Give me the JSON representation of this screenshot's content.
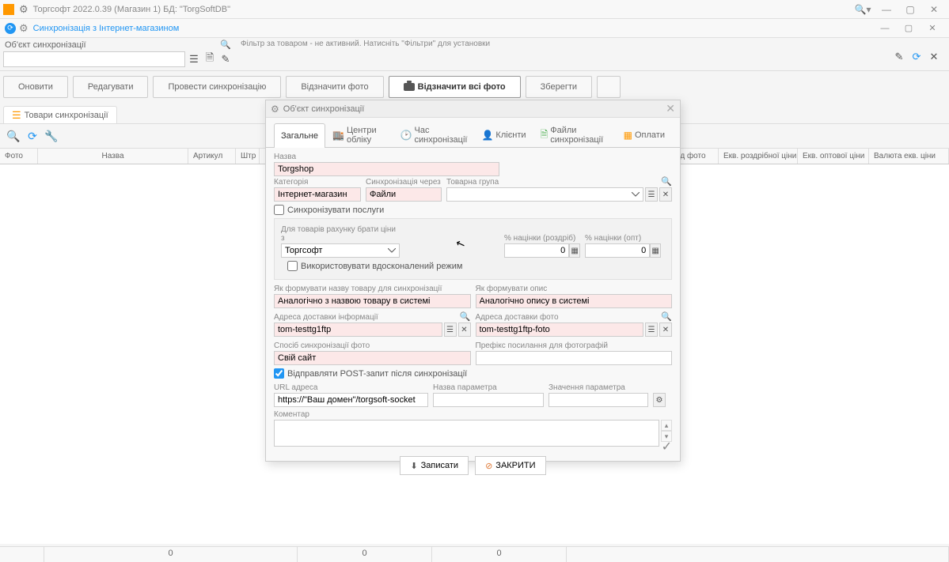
{
  "main_title": "Торгсофт 2022.0.39 (Магазин 1) БД: \"TorgSoftDB\"",
  "sub_title": "Синхронізація з Інтернет-магазином",
  "object_sync_label": "Об'єкт синхронізації",
  "filter_label": "Фільтр за товаром - не активний. Натисніть \"Фільтри\" для установки",
  "toolbar": {
    "refresh": "Оновити",
    "edit": "Редагувати",
    "sync": "Провести синхронізацію",
    "mark_photo": "Відзначити фото",
    "mark_all_photo": "Відзначити всі фото",
    "save": "Зберегти"
  },
  "app_tab": "Товари синхронізації",
  "grid_cols": {
    "photo": "Фото",
    "name": "Назва",
    "article": "Артикул",
    "barcode": "Штр",
    "under_photo": "од фото",
    "retail_eq": "Екв. роздрібної ціни",
    "wholesale_eq": "Екв. оптової ціни",
    "currency_eq": "Валюта екв. ціни"
  },
  "status": {
    "c1": "0",
    "c2": "0",
    "c3": "0"
  },
  "dialog": {
    "title": "Об'єкт синхронізації",
    "tabs": {
      "general": "Загальне",
      "centers": "Центри обліку",
      "time": "Час синхронізації",
      "clients": "Клієнти",
      "files": "Файли синхронізації",
      "payments": "Оплати"
    },
    "name_lbl": "Назва",
    "name_val": "Torgshop",
    "category_lbl": "Категорія",
    "category_val": "Інтернет-магазин",
    "sync_via_lbl": "Синхронізація через",
    "sync_via_val": "Файли",
    "group_lbl": "Товарна група",
    "group_val": "",
    "sync_services": "Синхронізувати послуги",
    "price_source_lbl": "Для товарів рахунку брати ціни з",
    "price_source_val": "Торгсофт",
    "advanced_mode": "Використовувати вдосконалений режим",
    "markup_retail_lbl": "% націнки (роздріб)",
    "markup_retail_val": "0",
    "markup_opt_lbl": "% націнки (опт)",
    "markup_opt_val": "0",
    "name_form_lbl": "Як формувати назву товару для синхронізації",
    "name_form_val": "Аналогічно з назвою товару в системі",
    "desc_form_lbl": "Як формувати опис",
    "desc_form_val": "Аналогічно опису в системі",
    "info_addr_lbl": "Адреса доставки інформації",
    "info_addr_val": "tom-testtg1ftp",
    "photo_addr_lbl": "Адреса доставки фото",
    "photo_addr_val": "tom-testtg1ftp-foto",
    "photo_sync_method_lbl": "Спосіб синхронізації фото",
    "photo_sync_method_val": "Свій сайт",
    "photo_prefix_lbl": "Префікс посилання для фотографій",
    "photo_prefix_val": "",
    "post_request": "Відправляти POST-запит після синхронізації",
    "url_lbl": "URL адреса",
    "url_val": "https://\"Ваш домен\"/torgsoft-socket",
    "param_name_lbl": "Назва параметра",
    "param_name_val": "",
    "param_val_lbl": "Значення параметра",
    "param_val_val": "",
    "comment_lbl": "Коментар",
    "comment_val": "",
    "write": "Записати",
    "close": "ЗАКРИТИ"
  }
}
